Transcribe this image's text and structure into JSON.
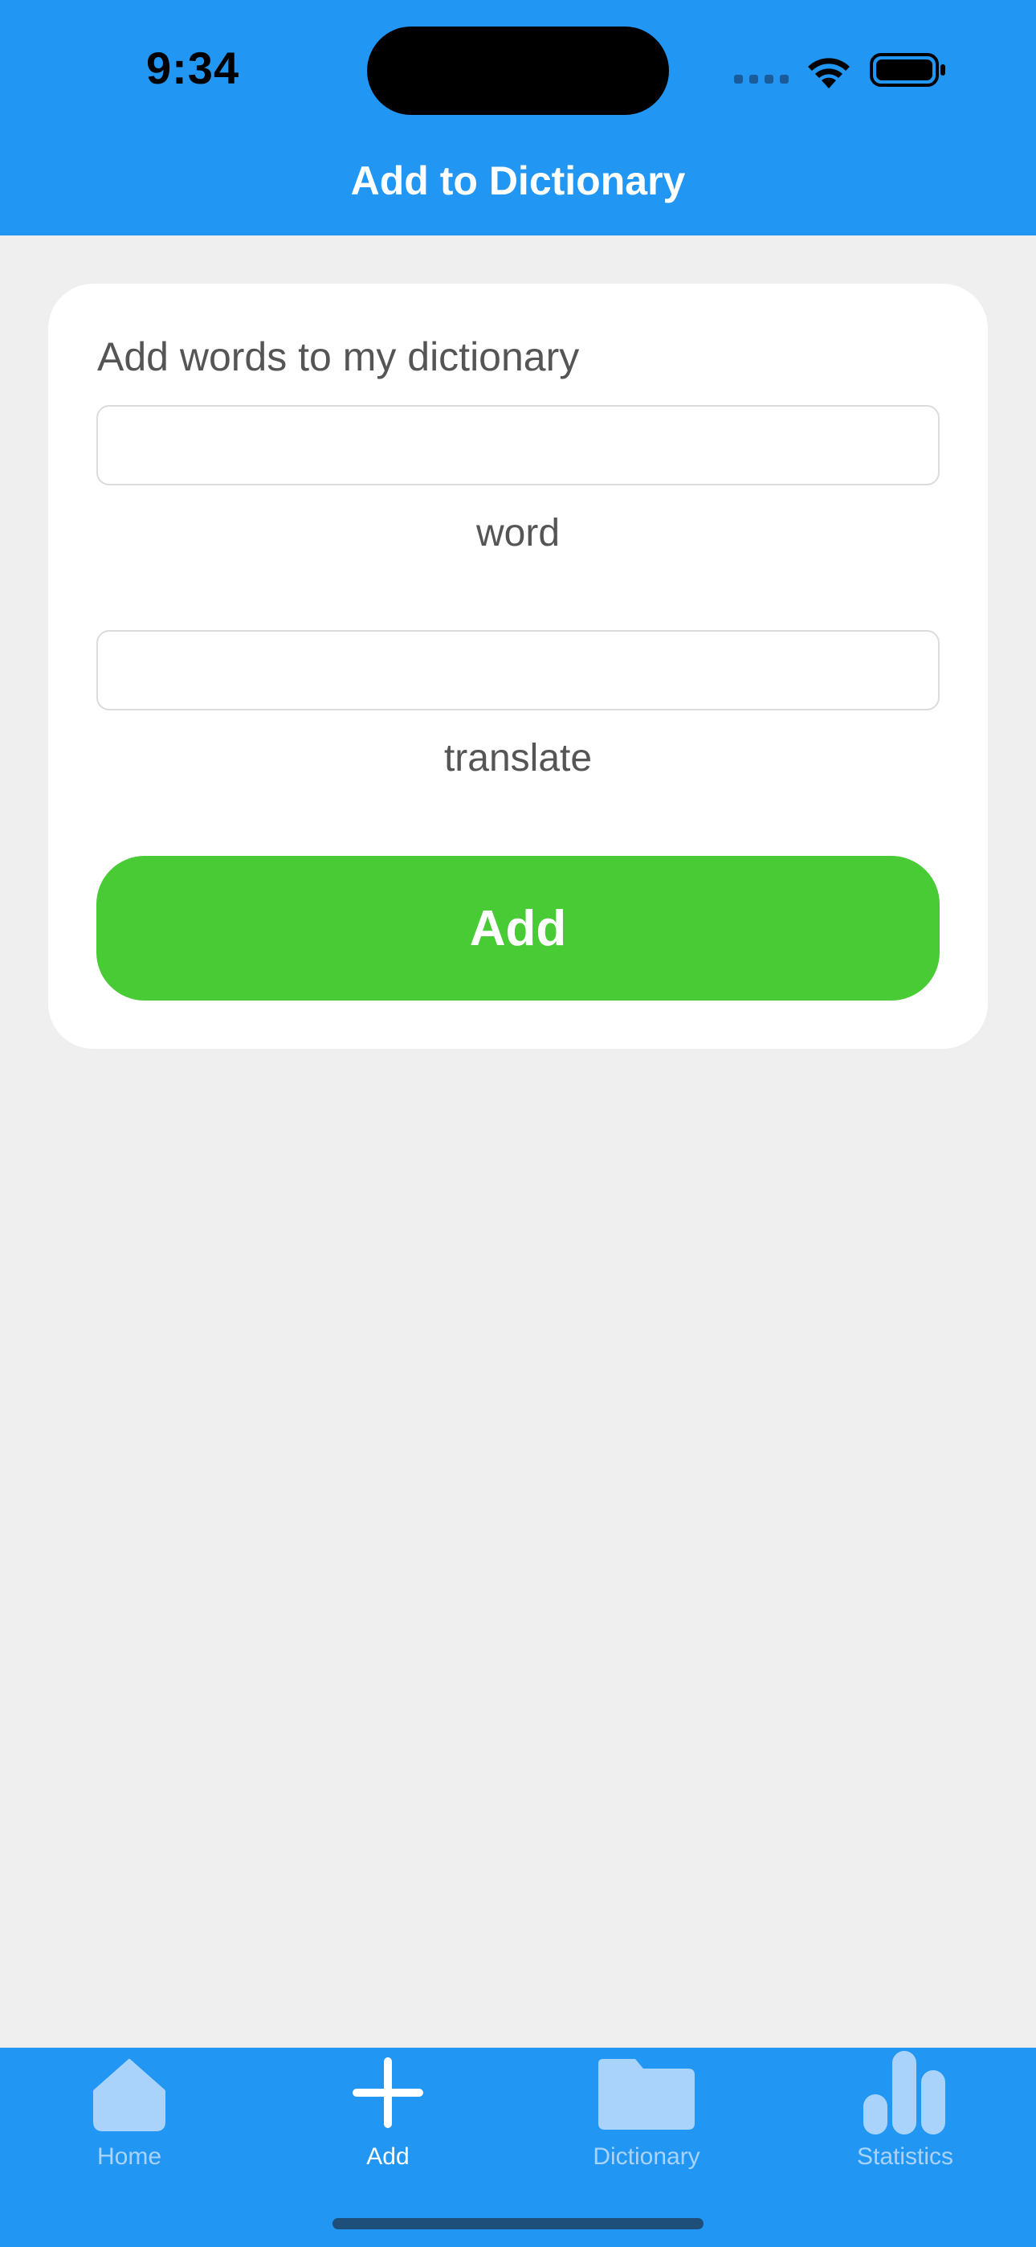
{
  "status_bar": {
    "time": "9:34",
    "icons": [
      "cellular-signal-icon",
      "wifi-icon",
      "battery-icon"
    ]
  },
  "header": {
    "title": "Add to Dictionary"
  },
  "form": {
    "title": "Add words to my dictionary",
    "word_field": {
      "value": "",
      "placeholder": "",
      "label": "word"
    },
    "translate_field": {
      "value": "",
      "placeholder": "",
      "label": "translate"
    },
    "submit_label": "Add"
  },
  "tabbar": {
    "tabs": [
      {
        "label": "Home",
        "icon": "home-icon",
        "active": false
      },
      {
        "label": "Add",
        "icon": "plus-icon",
        "active": true
      },
      {
        "label": "Dictionary",
        "icon": "folder-icon",
        "active": false
      },
      {
        "label": "Statistics",
        "icon": "bar-chart-icon",
        "active": false
      }
    ]
  },
  "colors": {
    "primary": "#2196f3",
    "background": "#efefef",
    "card": "#ffffff",
    "add_button": "#48cb35",
    "tab_inactive": "#a9d3fb",
    "tab_active": "#ffffff"
  }
}
